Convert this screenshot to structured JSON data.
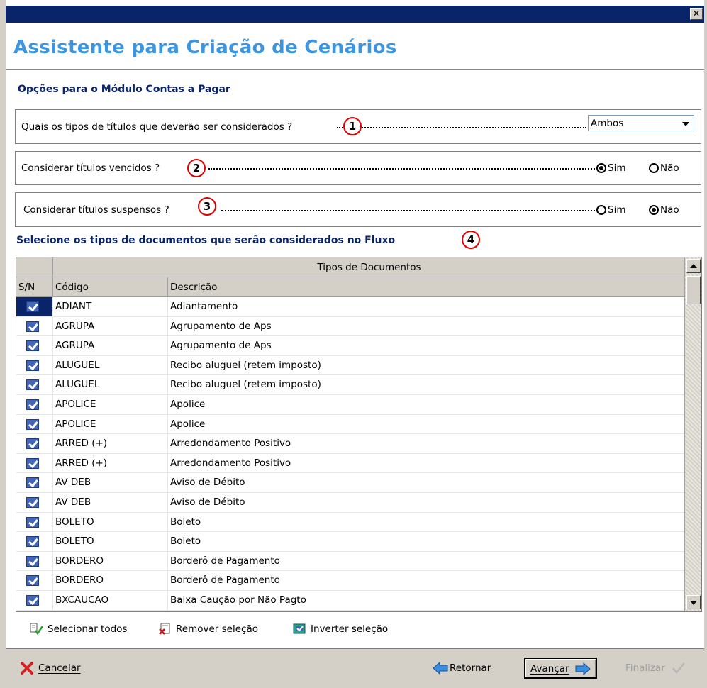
{
  "window": {
    "close_label": "✕"
  },
  "header": {
    "title": "Assistente para Criação de Cenários"
  },
  "section": {
    "title": "Opções para o Módulo Contas a Pagar"
  },
  "option1": {
    "question": "Quais os tipos de títulos que deverão ser considerados ?",
    "badge": "1",
    "selected": "Ambos"
  },
  "option2": {
    "question": "Considerar títulos vencidos ?",
    "badge": "2",
    "yes": "Sim",
    "no": "Não",
    "value": "Sim"
  },
  "option3": {
    "question": "Considerar títulos suspensos ?",
    "badge": "3",
    "yes": "Sim",
    "no": "Não",
    "value": "Não"
  },
  "documents": {
    "title": "Selecione os tipos de documentos que serão considerados no Fluxo",
    "badge": "4",
    "group_header": "Tipos de Documentos",
    "columns": {
      "sn": "S/N",
      "code": "Código",
      "desc": "Descrição"
    },
    "rows": [
      {
        "checked": true,
        "code": "ADIANT",
        "desc": "Adiantamento"
      },
      {
        "checked": true,
        "code": "AGRUPA",
        "desc": "Agrupamento de Aps"
      },
      {
        "checked": true,
        "code": "AGRUPA",
        "desc": "Agrupamento de Aps"
      },
      {
        "checked": true,
        "code": "ALUGUEL",
        "desc": "Recibo aluguel (retem imposto)"
      },
      {
        "checked": true,
        "code": "ALUGUEL",
        "desc": "Recibo aluguel (retem imposto)"
      },
      {
        "checked": true,
        "code": "APOLICE",
        "desc": "Apolice"
      },
      {
        "checked": true,
        "code": "APOLICE",
        "desc": "Apolice"
      },
      {
        "checked": true,
        "code": "ARRED (+)",
        "desc": "Arredondamento Positivo"
      },
      {
        "checked": true,
        "code": "ARRED (+)",
        "desc": "Arredondamento Positivo"
      },
      {
        "checked": true,
        "code": "AV DEB",
        "desc": "Aviso de Débito"
      },
      {
        "checked": true,
        "code": "AV DEB",
        "desc": "Aviso de Débito"
      },
      {
        "checked": true,
        "code": "BOLETO",
        "desc": "Boleto"
      },
      {
        "checked": true,
        "code": "BOLETO",
        "desc": "Boleto"
      },
      {
        "checked": true,
        "code": "BORDERO",
        "desc": "Borderô de Pagamento"
      },
      {
        "checked": true,
        "code": "BORDERO",
        "desc": "Borderô de Pagamento"
      },
      {
        "checked": true,
        "code": "BXCAUCAO",
        "desc": "Baixa Caução por Não Pagto"
      }
    ]
  },
  "selection": {
    "select_all": "Selecionar todos",
    "remove": "Remover seleção",
    "invert": "Inverter seleção"
  },
  "footer": {
    "cancel": "Cancelar",
    "back": "Retornar",
    "next": "Avançar",
    "finish": "Finalizar"
  },
  "colors": {
    "title_blue": "#3d94e0",
    "navy": "#0a246a",
    "badge_red": "#e00000"
  }
}
